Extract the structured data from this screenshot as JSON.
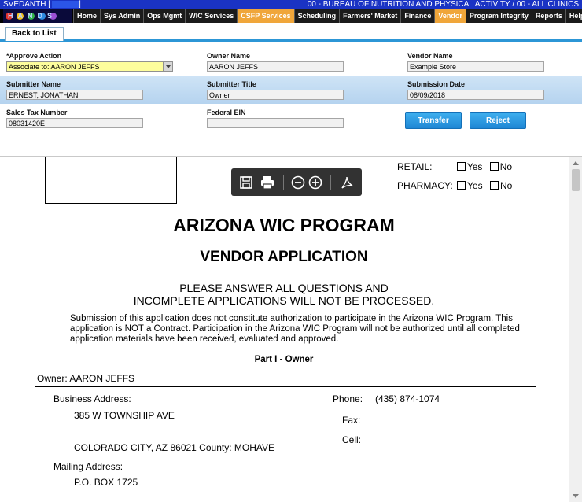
{
  "header": {
    "user": "SVEDANTH [",
    "org": "00 - BUREAU OF NUTRITION AND PHYSICAL ACTIVITY / 00 - ALL CLINICS",
    "logo_text": "HANDS"
  },
  "nav": {
    "items": [
      {
        "label": "Home"
      },
      {
        "label": "Sys Admin"
      },
      {
        "label": "Ops Mgmt"
      },
      {
        "label": "WIC Services"
      },
      {
        "label": "CSFP Services"
      },
      {
        "label": "Scheduling"
      },
      {
        "label": "Farmers' Market"
      },
      {
        "label": "Finance"
      },
      {
        "label": "Vendor"
      },
      {
        "label": "Program Integrity"
      },
      {
        "label": "Reports"
      },
      {
        "label": "Help"
      }
    ]
  },
  "tabs": {
    "back_label": "Back to List"
  },
  "form": {
    "approve_action_label": "*Approve Action",
    "approve_action_value": "Associate to: AARON JEFFS",
    "owner_name_label": "Owner Name",
    "owner_name_value": "AARON JEFFS",
    "vendor_name_label": "Vendor Name",
    "vendor_name_value": "Example Store",
    "submitter_name_label": "Submitter Name",
    "submitter_name_value": "ERNEST, JONATHAN",
    "submitter_title_label": "Submitter Title",
    "submitter_title_value": "Owner",
    "submission_date_label": "Submission Date",
    "submission_date_value": "08/09/2018",
    "sales_tax_label": "Sales Tax Number",
    "sales_tax_value": "08031420E",
    "federal_ein_label": "Federal EIN",
    "federal_ein_value": "",
    "transfer_label": "Transfer",
    "reject_label": "Reject"
  },
  "document": {
    "retail_label": "RETAIL:",
    "pharmacy_label": "PHARMACY:",
    "yes_label": "Yes",
    "no_label": "No",
    "title": "ARIZONA WIC PROGRAM",
    "subtitle": "VENDOR APPLICATION",
    "notice_line1": "PLEASE ANSWER ALL QUESTIONS AND",
    "notice_line2": "INCOMPLETE APPLICATIONS WILL NOT BE PROCESSED.",
    "paragraph": "Submission of this application does not constitute authorization to participate in the Arizona WIC Program. This application is NOT a Contract.  Participation in the Arizona WIC Program will not be authorized until all completed application materials have been received, evaluated and approved.",
    "part_heading": "Part I - Owner",
    "owner_line": "Owner: AARON JEFFS",
    "business_address_label": "Business Address:",
    "business_address_line1": "385 W TOWNSHIP AVE",
    "business_address_line2": "COLORADO CITY, AZ 86021  County: MOHAVE",
    "phone_label": "Phone:",
    "phone_value": "(435) 874-1074",
    "fax_label": "Fax:",
    "cell_label": "Cell:",
    "mailing_address_label": "Mailing Address:",
    "mailing_address_line1": "P.O. BOX 1725"
  },
  "colors": {
    "top_strip": "#1a33c4",
    "highlight_menu": "#f0a63a",
    "tab_rule": "#2c96d6",
    "select_bg": "#fdfd9c",
    "button": "#1e86d4"
  },
  "icons": {
    "save": "save-icon",
    "print": "print-icon",
    "zoom_out": "zoom-out-icon",
    "zoom_in": "zoom-in-icon",
    "acrobat": "acrobat-icon"
  }
}
